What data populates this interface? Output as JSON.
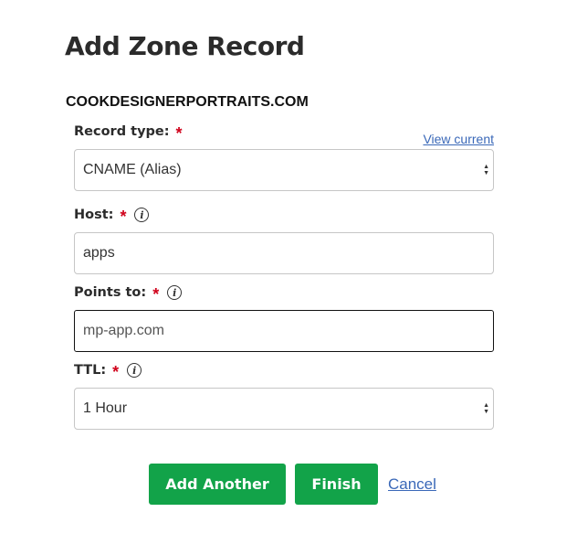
{
  "page": {
    "title": "Add Zone Record",
    "domain": "COOKDESIGNERPORTRAITS.COM"
  },
  "form": {
    "record_type": {
      "label": "Record type:",
      "required_mark": "*",
      "view_current": "View current",
      "value": "CNAME (Alias)"
    },
    "host": {
      "label": "Host:",
      "required_mark": "*",
      "info_icon": "i",
      "value": "apps"
    },
    "points_to": {
      "label": "Points to:",
      "required_mark": "*",
      "info_icon": "i",
      "value": "mp-app.com"
    },
    "ttl": {
      "label": "TTL:",
      "required_mark": "*",
      "info_icon": "i",
      "value": "1 Hour"
    }
  },
  "actions": {
    "add_another": "Add Another",
    "finish": "Finish",
    "cancel": "Cancel"
  },
  "colors": {
    "primary_button": "#12a349",
    "link": "#3a68b8",
    "required": "#d0021b"
  },
  "icons": {
    "info": "info-icon",
    "select_arrows": "select-arrows-icon"
  }
}
